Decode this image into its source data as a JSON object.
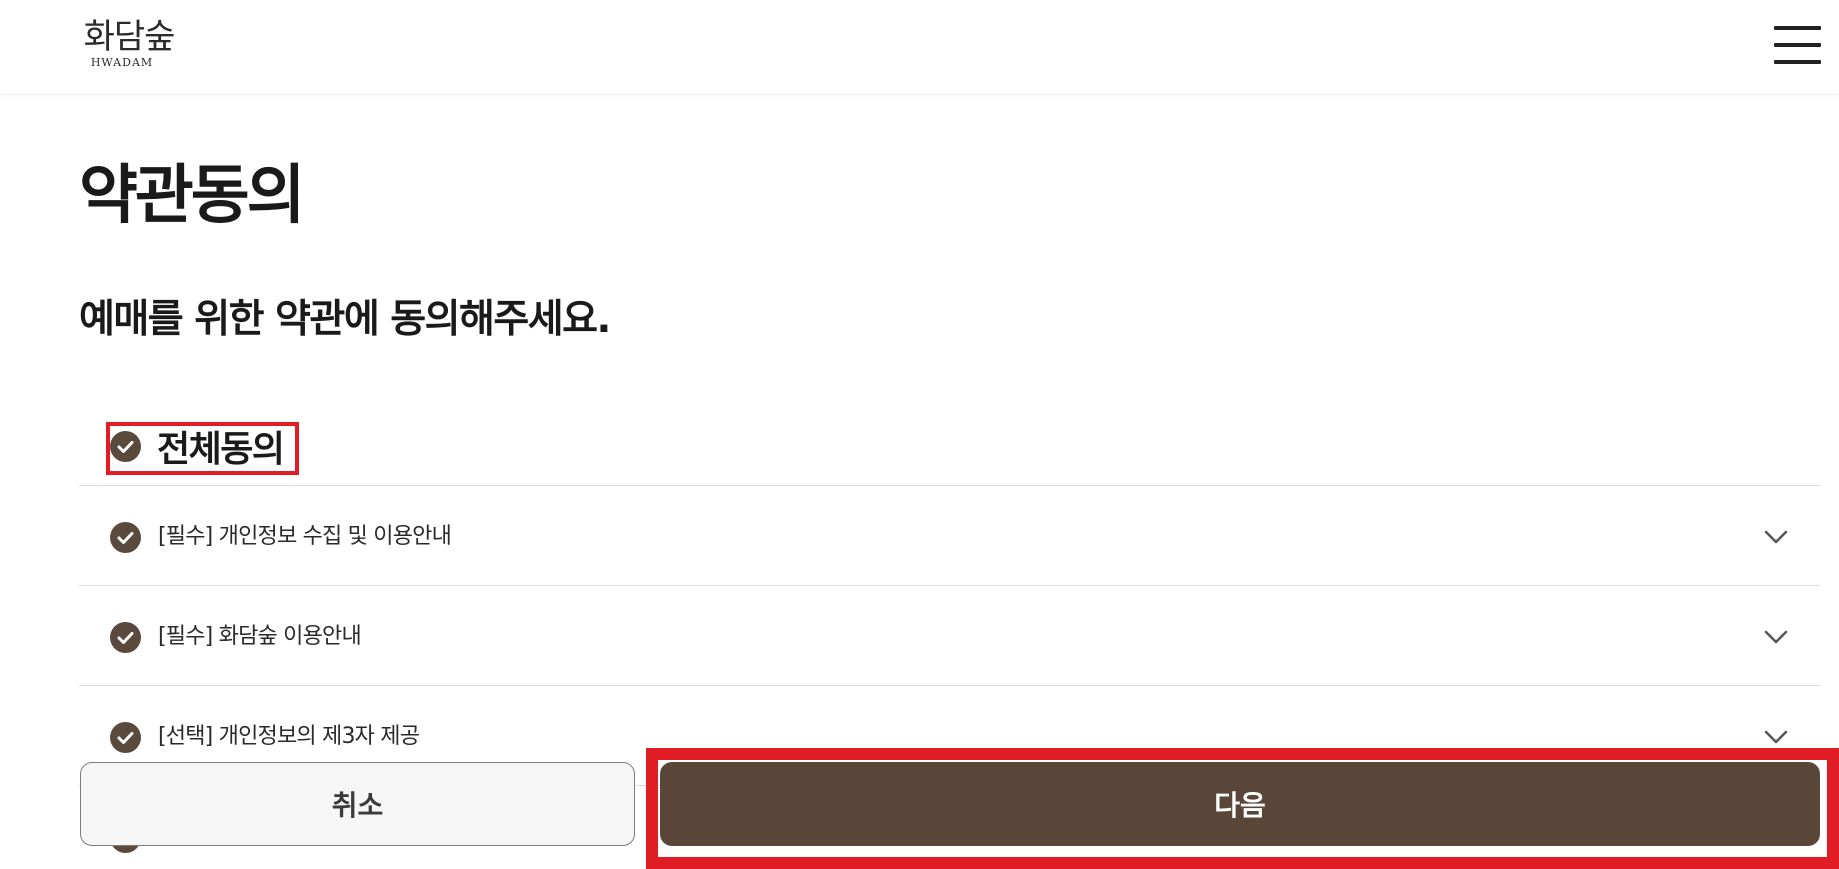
{
  "header": {
    "logo_ko": "화담숲",
    "logo_en": "HWADAM",
    "menu_icon": "hamburger-menu-icon"
  },
  "page_title": "약관동의",
  "subtitle": "예매를 위한 약관에 동의해주세요.",
  "agree_all": {
    "label": "전체동의",
    "checked": true,
    "icon": "check-circle-icon"
  },
  "terms": [
    {
      "label": "[필수] 개인정보 수집 및 이용안내",
      "checked": true,
      "icon": "chevron-down-icon"
    },
    {
      "label": "[필수] 화담숲 이용안내",
      "checked": true,
      "icon": "chevron-down-icon"
    },
    {
      "label": "[선택] 개인정보의 제3자 제공",
      "checked": true,
      "icon": "chevron-down-icon"
    }
  ],
  "buttons": {
    "cancel": "취소",
    "next": "다음"
  },
  "colors": {
    "brand_brown": "#5a4639",
    "check_fill": "#5a4a3e",
    "highlight_red": "#e01d24"
  }
}
